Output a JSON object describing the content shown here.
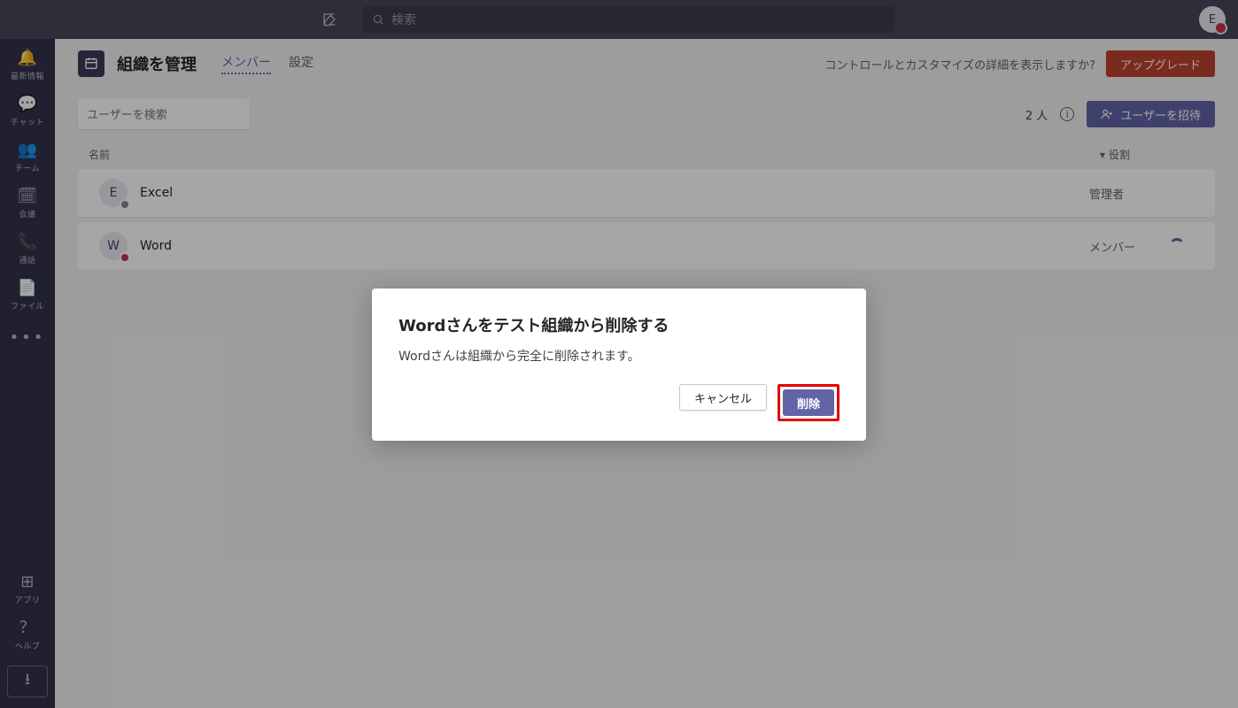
{
  "titlebar": {
    "search_placeholder": "検索",
    "avatar_letter": "E"
  },
  "rail": {
    "activity": "最新情報",
    "chat": "チャット",
    "teams": "チーム",
    "meetings": "会議",
    "calls": "通話",
    "files": "ファイル",
    "apps": "アプリ",
    "help": "ヘルプ"
  },
  "header": {
    "title": "組織を管理",
    "tabs": {
      "members": "メンバー",
      "settings": "設定"
    },
    "controls_text": "コントロールとカスタマイズの詳細を表示しますか?",
    "upgrade_label": "アップグレード"
  },
  "toolbar": {
    "search_placeholder": "ユーザーを検索",
    "count_text": "2 人",
    "invite_label": "ユーザーを招待"
  },
  "table": {
    "cols": {
      "name": "名前",
      "role": "役割"
    },
    "rows": [
      {
        "initial": "E",
        "name": "Excel",
        "role": "管理者",
        "avatar_bg": "#eae8ee",
        "avatar_fg": "#454367",
        "badge_color": "#8a8886",
        "loading": false
      },
      {
        "initial": "W",
        "name": "Word",
        "role": "メンバー",
        "avatar_bg": "#eae8ee",
        "avatar_fg": "#454367",
        "badge_color": "#c4314b",
        "loading": true
      }
    ]
  },
  "dialog": {
    "title": "Wordさんをテスト組織から削除する",
    "body": "Wordさんは組織から完全に削除されます。",
    "cancel_label": "キャンセル",
    "confirm_label": "削除"
  }
}
